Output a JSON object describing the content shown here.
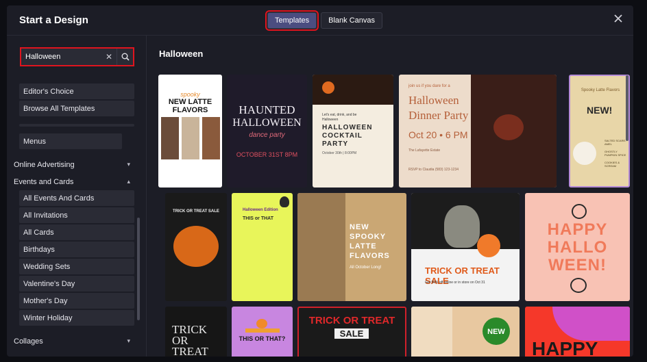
{
  "title": "Start a Design",
  "tabs": [
    {
      "label": "Templates"
    },
    {
      "label": "Blank Canvas"
    }
  ],
  "search": {
    "value": "Halloween"
  },
  "sidebar": {
    "items_top": [
      "Editor's Choice",
      "Browse All Templates"
    ],
    "menus": "Menus",
    "online_advertising": "Online Advertising",
    "events_and_cards": "Events and Cards",
    "sub_items": [
      "All Events And Cards",
      "All Invitations",
      "All Cards",
      "Birthdays",
      "Wedding Sets",
      "Valentine's Day",
      "Mother's Day",
      "Winter Holiday"
    ],
    "collages": "Collages"
  },
  "main": {
    "heading": "Halloween"
  },
  "cards": {
    "c1": {
      "l1": "spooky",
      "l2": "NEW LATTE FLAVORS"
    },
    "c2": {
      "l1": "HAUNTED",
      "l2": "HALLOWEEN",
      "l3": "dance party",
      "l4": "OCTOBER 31ST 8PM"
    },
    "c3": {
      "l1": "Let's eat, drink, and be Halloween",
      "l2": "HALLOWEEN",
      "l3": "COCKTAIL",
      "l4": "PARTY",
      "l5": "October 30th | 8:00PM"
    },
    "c4": {
      "l1": "join us if you dare for a",
      "l2": "Halloween",
      "l3": "Dinner Party",
      "l4": "Oct 20 • 6 PM",
      "l5": "The Lafayette Estate",
      "l6": "RSVP to Claudia (583) 123-1234"
    },
    "c5": {
      "l1": "Spooky Latte Flavors",
      "l2": "NEW!",
      "l3": "SALTED SCARE-AMEL",
      "l4": "GHOSTLY PUMPKIN SPICE",
      "l5": "COOKIES & SCREAM"
    },
    "c6": {
      "l1": "TRICK OR TREAT SALE"
    },
    "c7": {
      "l1": "Halloween Edition",
      "l2": "THIS or THAT"
    },
    "c8": {
      "l1": "NEW",
      "l2": "SPOOKY",
      "l3": "LATTE",
      "l4": "FLAVORS",
      "l5": "All October Long!"
    },
    "c9": {
      "l1": "TRICK OR TREAT SALE",
      "l2": "Get 50% off online or in store on Oct 31"
    },
    "c10": {
      "l1": "HAPPY",
      "l2": "HALLO",
      "l3": "WEEN!"
    },
    "c11": {
      "l1": "TRICK",
      "l2": "OR",
      "l3": "TREAT"
    },
    "c12": {
      "l1": "THIS OR THAT?"
    },
    "c13": {
      "l1": "TRICK OR TREAT",
      "l2": "SALE"
    },
    "c14": {
      "l1": "NEW"
    },
    "c15": {
      "l1": "HAPPY"
    }
  }
}
